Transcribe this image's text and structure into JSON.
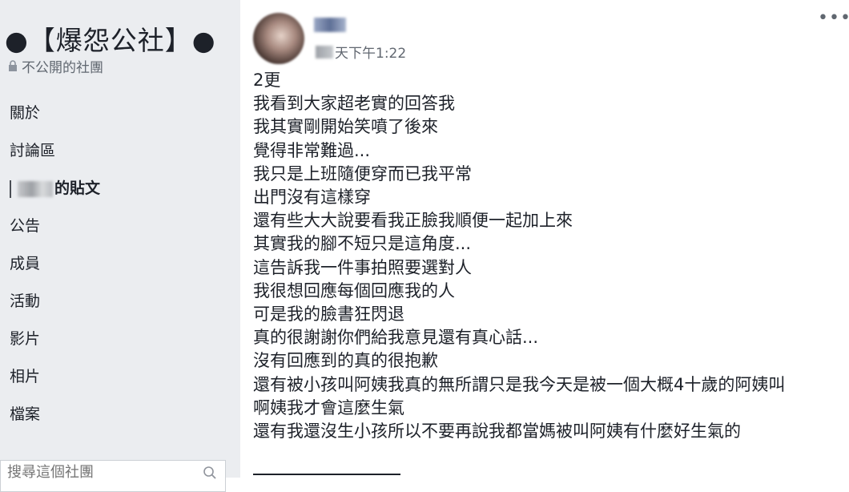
{
  "sidebar": {
    "group_name": "●【爆怨公社】●",
    "privacy_label": "不公開的社團",
    "nav_items": [
      {
        "label": "關於"
      },
      {
        "label": "討論區"
      },
      {
        "label": "的貼文"
      },
      {
        "label": "公告"
      },
      {
        "label": "成員"
      },
      {
        "label": "活動"
      },
      {
        "label": "影片"
      },
      {
        "label": "相片"
      },
      {
        "label": "檔案"
      }
    ],
    "search_placeholder": "搜尋這個社團"
  },
  "post": {
    "timestamp": "天下午1:22",
    "more_label": "•••",
    "lines": [
      "2更",
      "我看到大家超老實的回答我",
      "我其實剛開始笑噴了後來",
      "覺得非常難過...",
      "我只是上班隨便穿而已我平常",
      "出門沒有這樣穿",
      "還有些大大說要看我正臉我順便一起加上來",
      "其實我的腳不短只是這角度...",
      "這告訴我一件事拍照要選對人",
      "我很想回應每個回應我的人",
      "可是我的臉書狂閃退",
      "真的很謝謝你們給我意見還有真心話...",
      "沒有回應到的真的很抱歉",
      "還有被小孩叫阿姨我真的無所謂只是我今天是被一個大概4十歲的阿姨叫",
      "啊姨我才會這麼生氣",
      "還有我還沒生小孩所以不要再說我都當媽被叫阿姨有什麼好生氣的"
    ]
  },
  "icons": {
    "lock": "lock-icon",
    "search": "search-icon",
    "more": "more-options-icon"
  }
}
